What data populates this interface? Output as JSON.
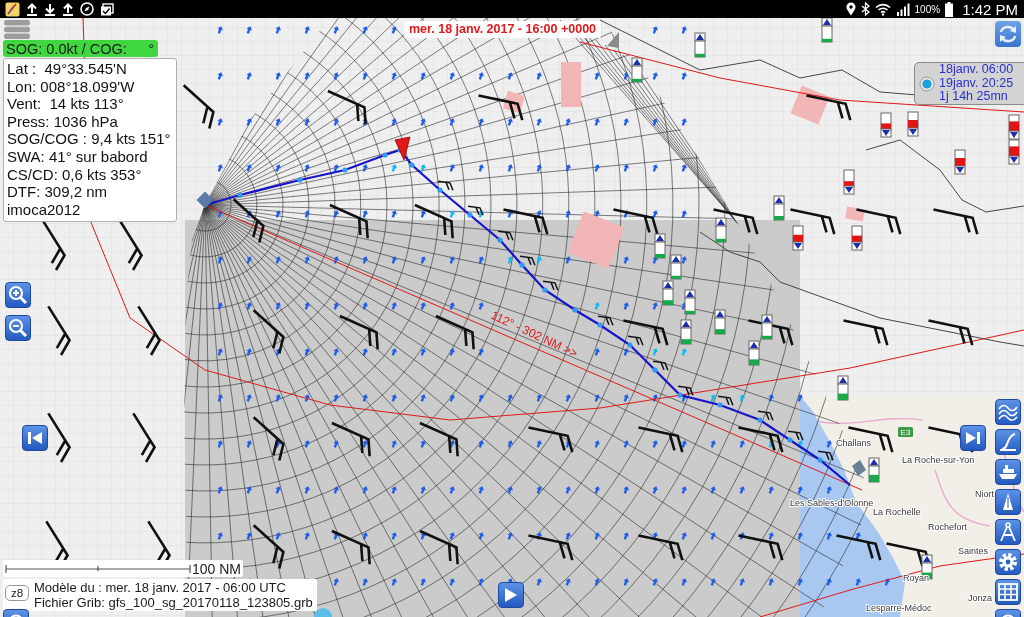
{
  "status_bar": {
    "battery_percent": "100%",
    "time": "1:42 PM"
  },
  "map": {
    "title": "mer. 18 janv. 2017 - 16:00 +0000",
    "route_label": "112° - 302 NM >>",
    "places": [
      {
        "name": "Challans"
      },
      {
        "name": "La Roche-sur-Yon"
      },
      {
        "name": "Niort"
      },
      {
        "name": "La Rochelle"
      },
      {
        "name": "Rochefort"
      },
      {
        "name": "Saintes"
      },
      {
        "name": "Royan"
      },
      {
        "name": "Jonza"
      },
      {
        "name": "Lesparre-Médoc"
      },
      {
        "name": "Les Sables-d'Olonne"
      }
    ],
    "road_badges": [
      {
        "label": "E3"
      }
    ],
    "gauges": [
      {
        "kind": "rising",
        "level": 0.2
      },
      {
        "kind": "rising",
        "level": 0.2
      },
      {
        "kind": "rising",
        "level": 0.2
      },
      {
        "kind": "falling",
        "level": 0.35
      },
      {
        "kind": "falling",
        "level": 0.5
      },
      {
        "kind": "falling",
        "level": 0.6
      },
      {
        "kind": "falling",
        "level": 0.6
      },
      {
        "kind": "falling",
        "level": 0.5
      },
      {
        "kind": "falling",
        "level": 0.3
      },
      {
        "kind": "rising",
        "level": 0.25
      },
      {
        "kind": "rising",
        "level": 0.2
      },
      {
        "kind": "falling",
        "level": 0.45
      },
      {
        "kind": "falling",
        "level": 0.4
      },
      {
        "kind": "rising",
        "level": 0.25
      },
      {
        "kind": "rising",
        "level": 0.2
      },
      {
        "kind": "rising",
        "level": 0.3
      },
      {
        "kind": "rising",
        "level": 0.2
      },
      {
        "kind": "rising",
        "level": 0.3
      },
      {
        "kind": "rising",
        "level": 0.3
      },
      {
        "kind": "rising",
        "level": 0.35
      },
      {
        "kind": "rising",
        "level": 0.2
      },
      {
        "kind": "rising",
        "level": 0.4
      },
      {
        "kind": "rising",
        "level": 0.45
      },
      {
        "kind": "rising",
        "level": 0.4
      }
    ]
  },
  "sog_badge": {
    "text": "SOG: 0.0kt / COG:",
    "unit": "°"
  },
  "info_panel": {
    "lines": [
      "Lat :  49°33.545'N",
      "Lon: 008°18.099'W",
      "Vent:  14 kts 113°",
      "Press: 1036 hPa",
      "SOG/COG : 9,4 kts 151°",
      "SWA: 41° sur babord",
      "CS/CD: 0,6 kts 353°",
      "DTF: 309,2 nm",
      "imoca2012"
    ]
  },
  "time_panel": {
    "selected": true,
    "start": "18janv. 06:00",
    "end": "19janv. 20:25",
    "duration": "1j 14h 25mn"
  },
  "scale": {
    "label": "100 NM"
  },
  "model_info": {
    "lines": [
      "Modèle du : mer. 18 janv. 2017 - 06:00 UTC",
      "Fichier Grib: gfs_100_sg_20170118_123805.grb"
    ]
  },
  "zoom_level": "z8"
}
